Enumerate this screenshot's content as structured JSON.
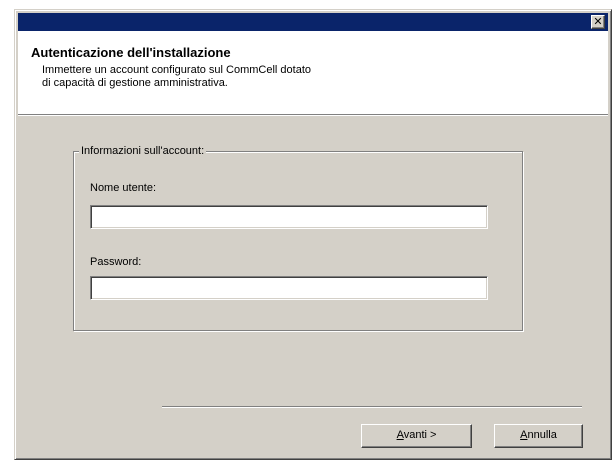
{
  "titlebar": {
    "close_glyph": "✕"
  },
  "header": {
    "title": "Autenticazione dell'installazione",
    "description_line1": "Immettere un account configurato sul CommCell dotato",
    "description_line2": "di capacità di gestione amministrativa."
  },
  "account_group": {
    "legend": "Informazioni sull'account:",
    "username_label": "Nome utente:",
    "username_value": "",
    "password_label": "Password:",
    "password_value": ""
  },
  "buttons": {
    "next_accel": "A",
    "next_rest": "vanti >",
    "cancel_accel": "A",
    "cancel_rest": "nnulla"
  },
  "colors": {
    "titlebar": "#0a246a",
    "dialog_face": "#d4d0c8",
    "header_bg": "#ffffff"
  }
}
